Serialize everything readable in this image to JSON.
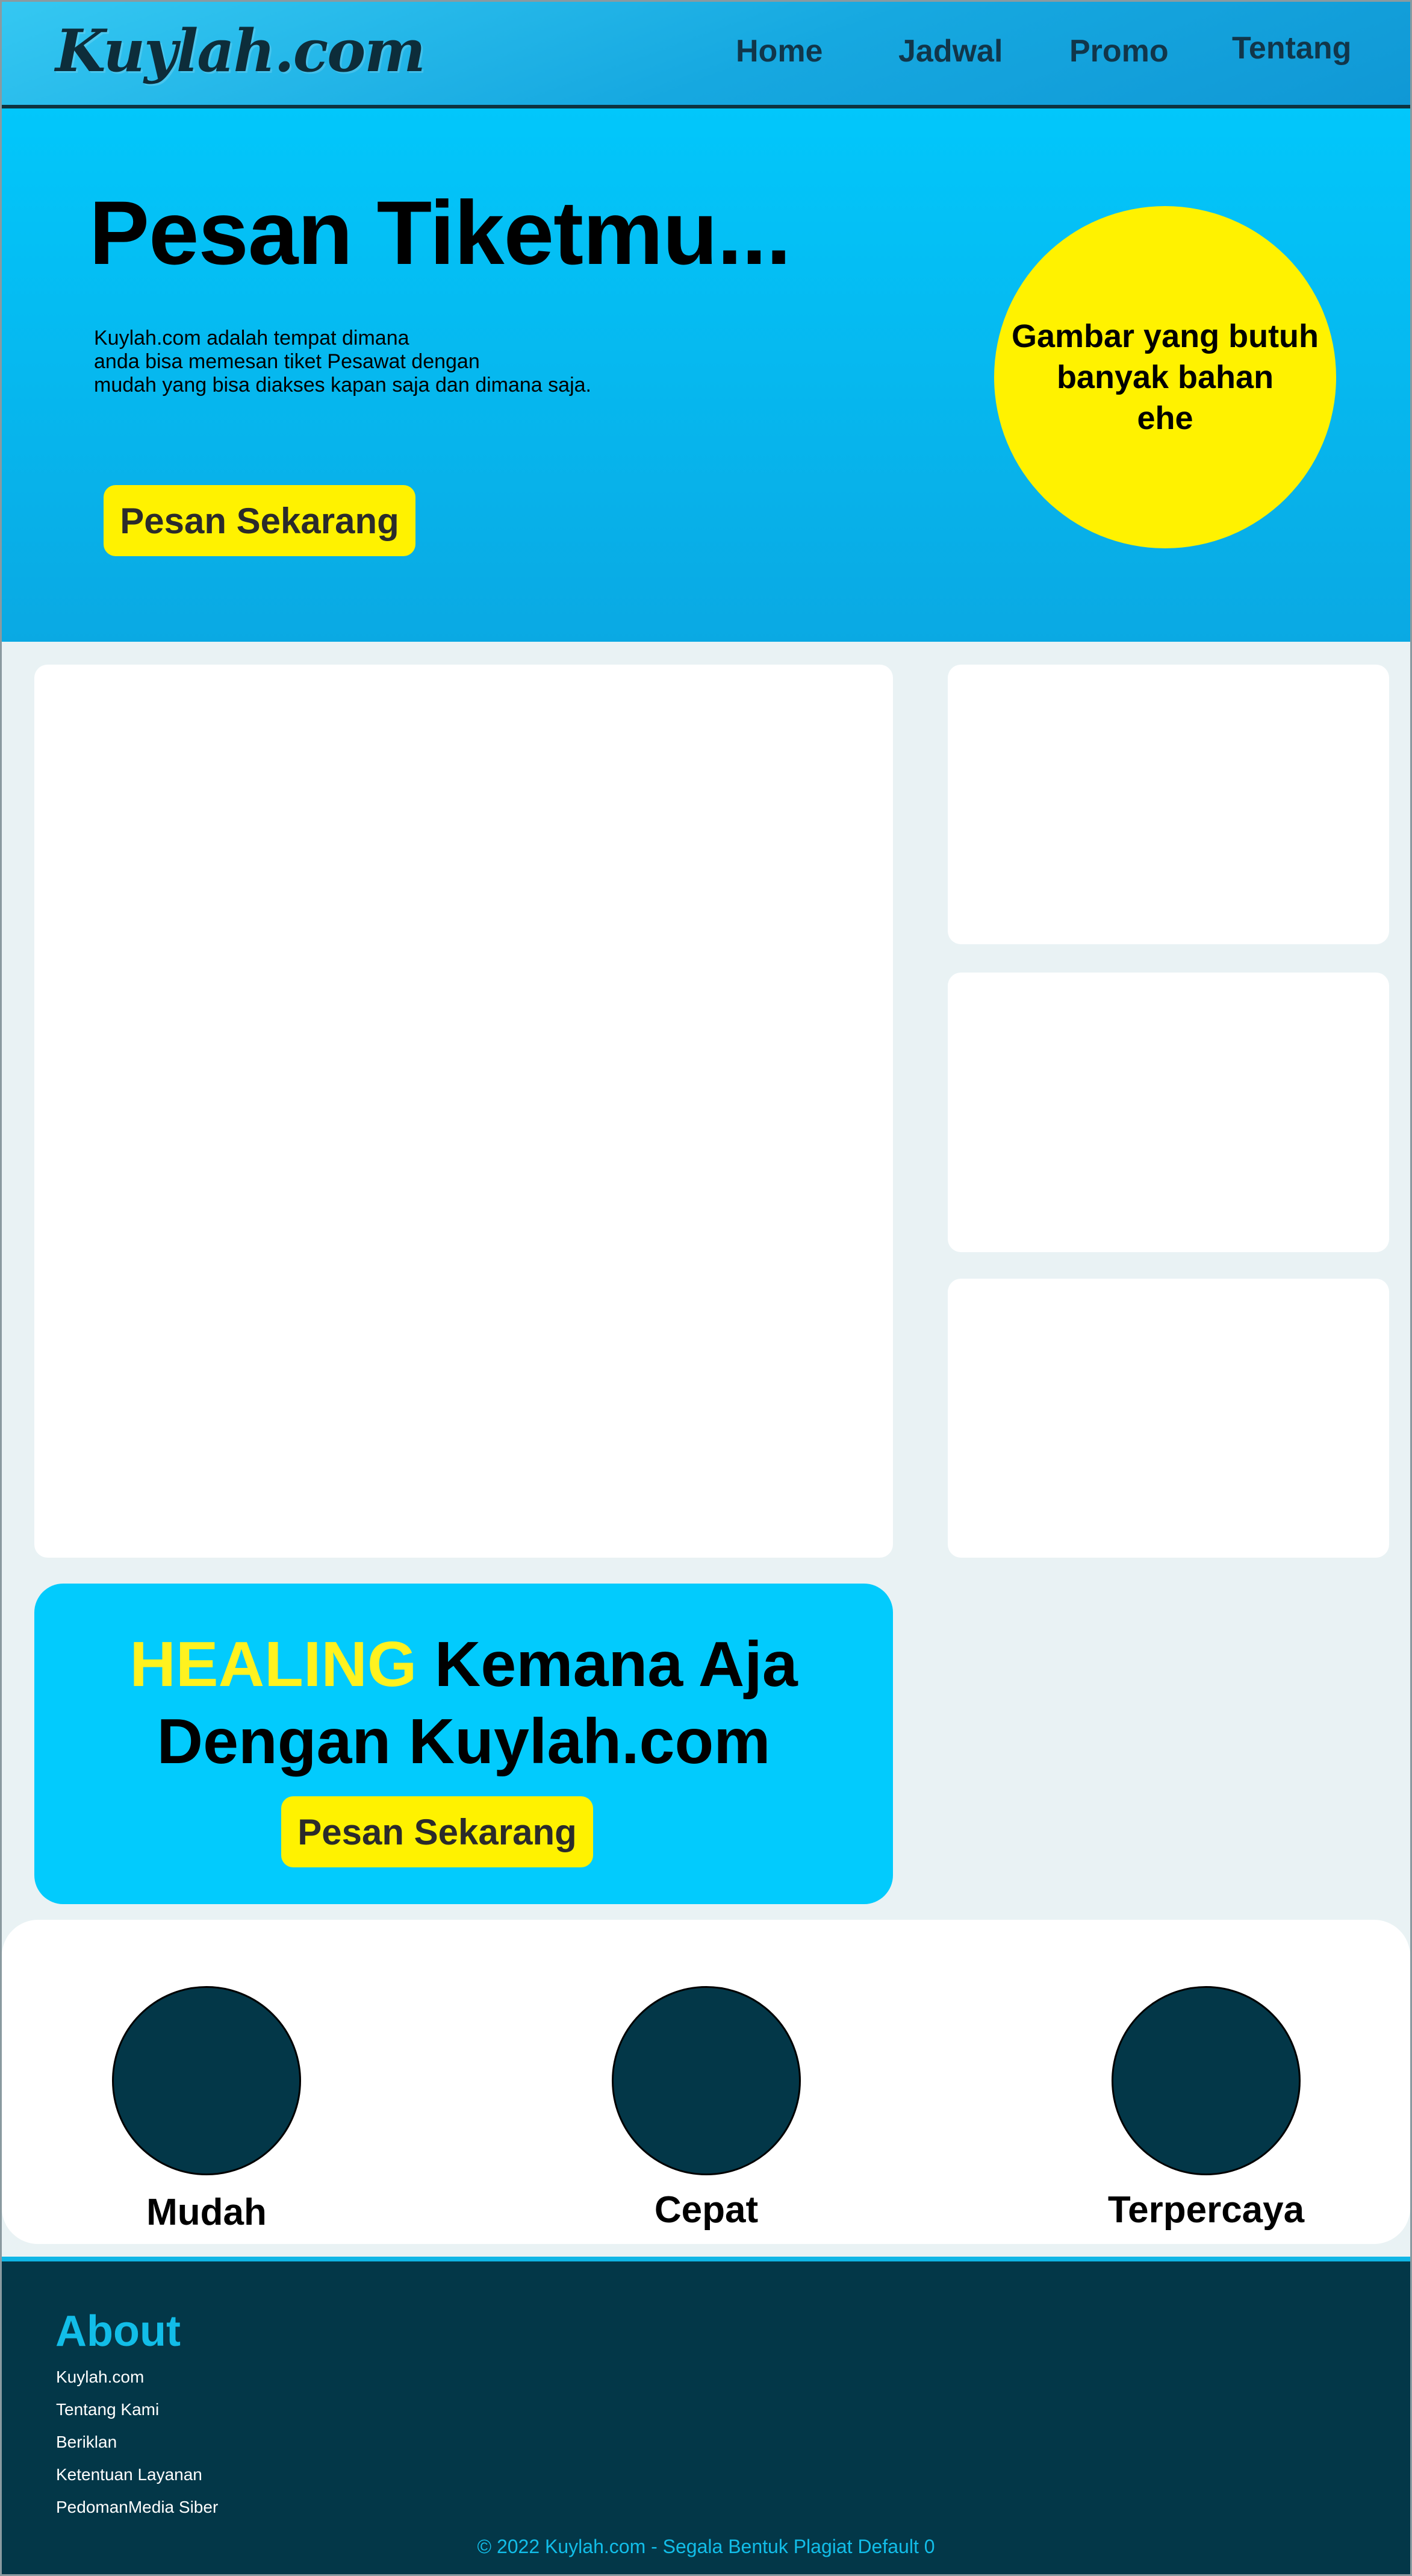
{
  "header": {
    "logo": "Kuylah.com",
    "nav": [
      "Home",
      "Jadwal",
      "Promo",
      "Tentang"
    ]
  },
  "hero": {
    "title": "Pesan Tiketmu...",
    "description_lines": [
      "Kuylah.com adalah tempat dimana",
      "anda bisa memesan tiket Pesawat dengan",
      "mudah yang bisa diakses kapan saja dan dimana saja."
    ],
    "button_label": "Pesan Sekarang",
    "image_placeholder_lines": [
      "Gambar yang butuh",
      "banyak bahan",
      "ehe"
    ]
  },
  "promo": {
    "highlight": "HEALING",
    "title_rest_line1": " Kemana Aja",
    "title_line2": "Dengan Kuylah.com",
    "button_label": "Pesan Sekarang"
  },
  "features": [
    "Mudah",
    "Cepat",
    "Terpercaya"
  ],
  "footer": {
    "about_title": "About",
    "links": [
      "Kuylah.com",
      "Tentang Kami",
      "Beriklan",
      "Ketentuan Layanan",
      "PedomanMedia Siber"
    ],
    "copyright": "© 2022 Kuylah.com - Segala Bentuk Plagiat Default 0"
  },
  "colors": {
    "accent_yellow": "#fff200",
    "accent_cyan": "#02cbfd",
    "dark_teal": "#033748",
    "background": "#e9f2f4"
  }
}
